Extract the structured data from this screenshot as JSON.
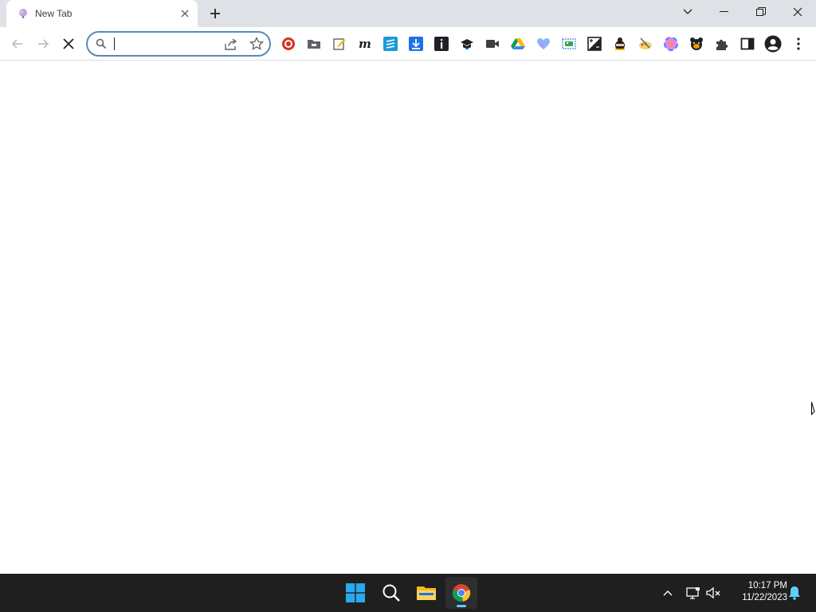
{
  "window": {
    "tab": {
      "title": "New Tab"
    }
  },
  "toolbar": {
    "omnibox": {
      "value": "",
      "placeholder": ""
    }
  },
  "extensions": [
    "bgc-red-icon",
    "folder-icon",
    "edit-note-icon",
    "m-italic-icon",
    "blue-s-icon",
    "download-arrow-icon",
    "info-icon",
    "graduation-cap-icon",
    "video-camera-icon",
    "drive-icon",
    "heart-icon",
    "screenshot-icon",
    "contrast-icon",
    "ninja-icon",
    "paint-icon",
    "colorful-circle-icon",
    "bear-icon"
  ],
  "taskbar": {
    "time": "10:17 PM",
    "date": "11/22/2023"
  },
  "colors": {
    "tabstrip": "#dee1e6",
    "omnibox_border": "#5b89b5",
    "taskbar": "#1f1f1f",
    "accent": "#60cdff"
  }
}
